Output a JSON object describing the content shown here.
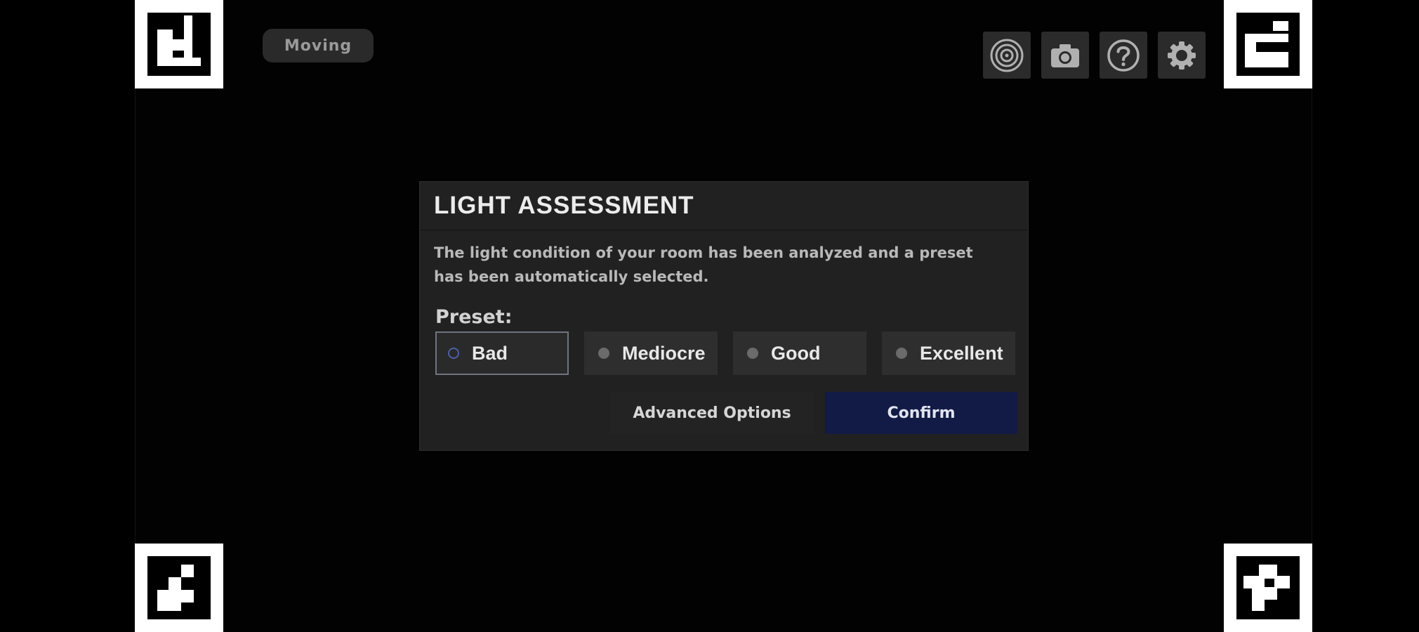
{
  "status": {
    "label": "Moving"
  },
  "toolbar": {
    "items": [
      {
        "icon": "target-icon"
      },
      {
        "icon": "camera-icon"
      },
      {
        "icon": "help-icon"
      },
      {
        "icon": "gear-icon"
      }
    ]
  },
  "dialog": {
    "title": "LIGHT ASSESSMENT",
    "message": "The light condition of your room has been analyzed and a preset has been automatically selected.",
    "preset_label": "Preset:",
    "presets": [
      {
        "label": "Bad",
        "selected": true
      },
      {
        "label": "Mediocre",
        "selected": false
      },
      {
        "label": "Good",
        "selected": false
      },
      {
        "label": "Excellent",
        "selected": false
      }
    ],
    "advanced_label": "Advanced Options",
    "confirm_label": "Confirm"
  },
  "colors": {
    "background": "#000000",
    "dialog_bg": "#212121",
    "confirm_bg": "#111b45",
    "selected_radio": "#4b5fa8"
  }
}
